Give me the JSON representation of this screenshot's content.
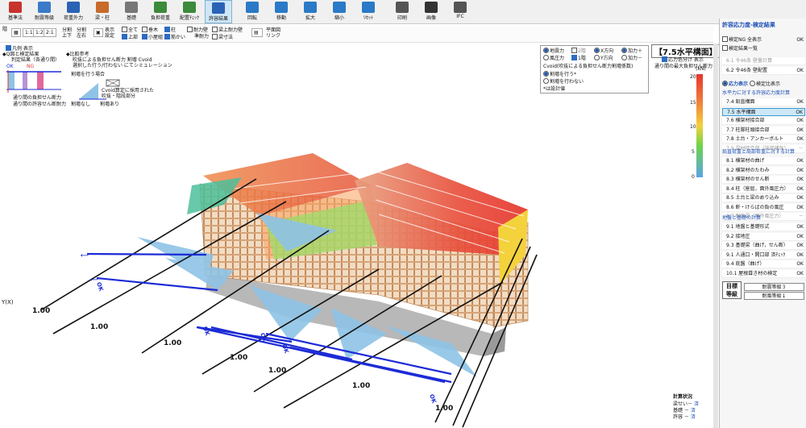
{
  "toolbar": {
    "items": [
      {
        "label": "基準法",
        "icon": "house-roof-icon",
        "color": "#c8322c"
      },
      {
        "label": "耐震等級",
        "icon": "stars-icon",
        "color": "#3a7ac8"
      },
      {
        "label": "荷重外力",
        "icon": "load-icon",
        "color": "#2a62b5"
      },
      {
        "label": "梁・柱",
        "icon": "beam-icon",
        "color": "#c86a2a"
      },
      {
        "label": "基礎",
        "icon": "foundation-icon",
        "color": "#777777"
      },
      {
        "label": "負担荷重",
        "icon": "load-area-icon",
        "color": "#3c8a3c"
      },
      {
        "label": "配置ﾁｪｯｸ",
        "icon": "layout-check-icon",
        "color": "#3c8a3c"
      },
      {
        "label": "許容結果",
        "icon": "result-icon",
        "color": "#2a62b5"
      },
      {
        "label": "回転",
        "icon": "rotate-icon",
        "color": "#2a7ac8"
      },
      {
        "label": "移動",
        "icon": "move-icon",
        "color": "#2a7ac8"
      },
      {
        "label": "拡大",
        "icon": "zoom-in-icon",
        "color": "#2a7ac8"
      },
      {
        "label": "縮小",
        "icon": "zoom-out-icon",
        "color": "#2a7ac8"
      },
      {
        "label": "ﾘｾｯﾄ",
        "icon": "reset-icon",
        "color": "#2a7ac8"
      },
      {
        "label": "印刷",
        "icon": "print-icon",
        "color": "#555555"
      },
      {
        "label": "画像",
        "icon": "camera-icon",
        "color": "#333333"
      },
      {
        "label": "IFC",
        "icon": "ifc-icon",
        "color": "#555555"
      }
    ]
  },
  "toolbar2": {
    "view": "階",
    "scale_1": "1:1",
    "scale_2": "1:2",
    "scale_3": "2:1",
    "split_v_1": "分割",
    "split_v_2": "上下",
    "split_h_1": "分割",
    "split_h_2": "左右",
    "display_1": "表示",
    "display_2": "設定",
    "cb_all": "全て",
    "cb_upper": "上部",
    "cb_vertical": "垂木",
    "cb_attic": "小屋組",
    "cb_column": "柱",
    "cb_brace": "筋かい",
    "cb_wall": "耐力壁",
    "cb_semi": "準耐力",
    "cb_beam_wall": "梁上耐力壁",
    "cb_beam_dim": "梁寸法",
    "plan_link_1": "平面図",
    "plan_link_2": "リンク"
  },
  "legend": {
    "title": "凡例 表示",
    "l1": "◆Q図と検定結果",
    "l2": "判定結果（各通り間）",
    "ok": "OK",
    "ng": "NG",
    "l3": "通り間の負担せん断力",
    "l4": "通り間の許容せん断耐力",
    "l5": "◆比較参考",
    "l6": "吹抜による負担せん断力 割増 Cvoid",
    "l7": "選択した行う/行わない にてシミュレーション",
    "l8": "割増を行う場合",
    "l9": "Cvoid算定に採用された",
    "l10": "吹抜・階段部分",
    "l11": "割増なし",
    "l12": "割増あり"
  },
  "options": {
    "seismic": "地震力",
    "wind": "風圧力",
    "floor2": "2階",
    "floor1": "1階",
    "xdir": "X方向",
    "ydir": "Y方向",
    "plus": "加力＋",
    "minus": "加力－",
    "cvoid_title": "Cvoid(吹抜による負担せん断力割増係数)",
    "do": "割増を行う*",
    "dont": "割増を行わない",
    "note": "*は設計値"
  },
  "scale": {
    "title": "【7.5水平構面】",
    "cb_label": "応力色分け 表示",
    "subtitle": "通り間の最大負担せん断力",
    "unit": "(kN)",
    "ticks": [
      "20",
      "15",
      "10",
      "5",
      "0"
    ]
  },
  "viewport": {
    "label": "1.00",
    "side": "Y(X)"
  },
  "calc_status": {
    "title": "計算状況",
    "r1_label": "梁せい－",
    "r1_value": "済",
    "r2_label": "基礎 －",
    "r2_value": "済",
    "r3_label": "許容 －",
    "r3_value": "済"
  },
  "right_panel": {
    "header": "許容応力度-検定結果",
    "ng_all": "検定NG 全表示",
    "ok_label": "OK",
    "list": "検定結果一覧",
    "sec6_1": "6.1  令46条 壁量計算",
    "sec6_2": "6.2  令46条 壁配置",
    "tab_stress": "応力表示",
    "tab_result": "検定比表示",
    "group1": "水平力に対する許容応力度計算",
    "items1": [
      {
        "label": "7.4  鉛直構面",
        "st": "OK",
        "cls": ""
      },
      {
        "label": "7.5  水平構面",
        "st": "OK",
        "cls": "sel"
      },
      {
        "label": "7.6  横架材接合部",
        "st": "OK",
        "cls": ""
      },
      {
        "label": "7.7  柱脚柱頭接合部",
        "st": "OK",
        "cls": ""
      },
      {
        "label": "7.8  土台・アンカーボルト",
        "st": "OK",
        "cls": ""
      },
      {
        "label": "7.9  梁材接合部（端部補強）",
        "st": "－",
        "cls": "dim"
      }
    ],
    "group2": "鉛直荷重と局部荷重に対する計算",
    "items2": [
      {
        "label": "8.1  横架材の曲げ",
        "st": "OK",
        "cls": ""
      },
      {
        "label": "8.2  横架材のたわみ",
        "st": "OK",
        "cls": ""
      },
      {
        "label": "8.3  横架材のせん断",
        "st": "OK",
        "cls": ""
      },
      {
        "label": "8.4  柱（座屈，面外風圧力）",
        "st": "OK",
        "cls": ""
      },
      {
        "label": "8.5  土台と梁のめり込み",
        "st": "OK",
        "cls": ""
      },
      {
        "label": "8.6  軒・けらばの負の風圧",
        "st": "OK",
        "cls": ""
      },
      {
        "label": "8.7  耐風梁（面外風圧力）",
        "st": "－",
        "cls": "dim"
      }
    ],
    "group3": "地盤と基礎の計算",
    "items3": [
      {
        "label": "9.1  地盤と基礎形式",
        "st": "OK",
        "cls": ""
      },
      {
        "label": "9.2  接地圧",
        "st": "OK",
        "cls": ""
      },
      {
        "label": "9.3  基礎梁（曲げ，せん断）",
        "st": "OK",
        "cls": ""
      },
      {
        "label": "9.1  人通口・開口部  済ﾁｪｯｸ",
        "st": "OK",
        "cls": ""
      },
      {
        "label": "9.4  底盤（曲げ）",
        "st": "OK",
        "cls": ""
      },
      {
        "label": "10.1  屋根葺き材の検定",
        "st": "OK",
        "cls": ""
      }
    ],
    "target_1": "目標",
    "target_2": "等級",
    "grade_seismic": "耐震等級３",
    "grade_wind": "耐風等級１"
  },
  "colors": {
    "accent": "#1d4fb8",
    "diagram_fill": "#8ec3e6",
    "beam_blue": "#1c2bd6",
    "wood": "#d9a77a",
    "heat_hot": "#e8463c",
    "heat_mid": "#f3d23c",
    "heat_cool": "#6bd34c",
    "heat_cold": "#5aa3e8"
  }
}
